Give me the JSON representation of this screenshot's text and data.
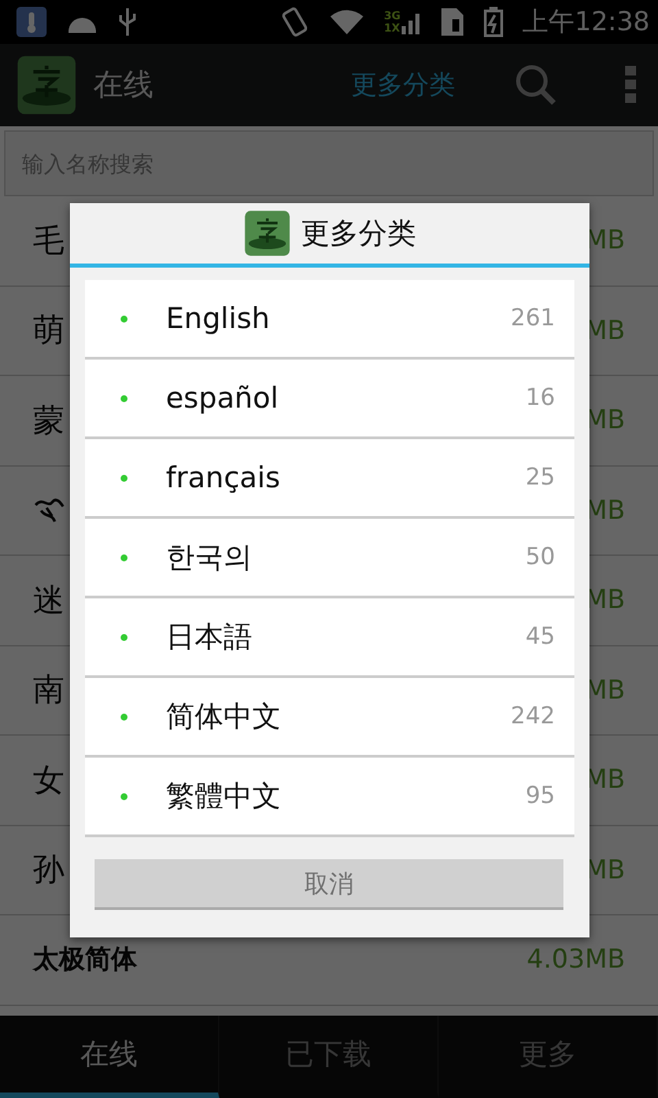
{
  "status_bar": {
    "network_labels": [
      "3G",
      "1X"
    ],
    "time": "上午12:38"
  },
  "action_bar": {
    "title": "在线",
    "category_button": "更多分类"
  },
  "search": {
    "placeholder": "输入名称搜索"
  },
  "fonts": [
    {
      "kind": "text",
      "name": "毛",
      "size": "MB",
      "bold": false
    },
    {
      "kind": "text",
      "name": "萌",
      "size": "MB",
      "bold": false
    },
    {
      "kind": "text",
      "name": "蒙",
      "size": "MB",
      "bold": false
    },
    {
      "kind": "ornament",
      "size": "MB"
    },
    {
      "kind": "text",
      "name": "迷",
      "size": "MB",
      "bold": false
    },
    {
      "kind": "text",
      "name": "南",
      "size": "MB",
      "bold": false
    },
    {
      "kind": "text",
      "name": "女",
      "size": "MB",
      "bold": false
    },
    {
      "kind": "text",
      "name": "孙",
      "size": "MB",
      "bold": false
    },
    {
      "kind": "text",
      "name": "太极简体",
      "size": "4.03MB",
      "bold": true
    }
  ],
  "dialog": {
    "title": "更多分类",
    "items": [
      {
        "label": "English",
        "count": "261"
      },
      {
        "label": "español",
        "count": "16"
      },
      {
        "label": "français",
        "count": "25"
      },
      {
        "label": "한국의",
        "count": "50"
      },
      {
        "label": "日本語",
        "count": "45"
      },
      {
        "label": "简体中文",
        "count": "242"
      },
      {
        "label": "繁體中文",
        "count": "95"
      }
    ],
    "cancel": "取消"
  },
  "tabs": [
    {
      "label": "在线",
      "selected": true
    },
    {
      "label": "已下载",
      "selected": false
    },
    {
      "label": "更多",
      "selected": false
    }
  ]
}
